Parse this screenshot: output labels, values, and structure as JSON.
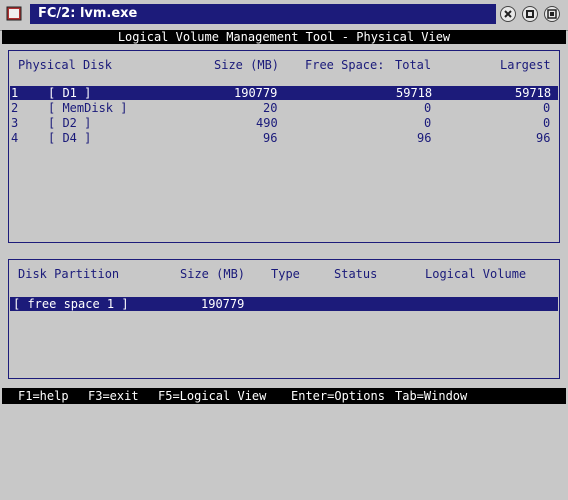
{
  "window": {
    "title": "FC/2: lvm.exe"
  },
  "header": {
    "title": "Logical Volume Management Tool - Physical View"
  },
  "disks_panel": {
    "columns": {
      "name": "Physical Disk",
      "size": "Size (MB)",
      "free": "Free Space:",
      "total": "Total",
      "largest": "Largest"
    },
    "rows": [
      {
        "num": "1",
        "name": "[ D1 ]",
        "size": "190779",
        "total": "59718",
        "largest": "59718",
        "selected": true
      },
      {
        "num": "2",
        "name": "[ MemDisk ]",
        "size": "20",
        "total": "0",
        "largest": "0"
      },
      {
        "num": "3",
        "name": "[ D2 ]",
        "size": "490",
        "total": "0",
        "largest": "0"
      },
      {
        "num": "4",
        "name": "[ D4 ]",
        "size": "96",
        "total": "96",
        "largest": "96"
      }
    ]
  },
  "partitions_panel": {
    "columns": {
      "name": "Disk Partition",
      "size": "Size (MB)",
      "type": "Type",
      "status": "Status",
      "volume": "Logical Volume"
    },
    "rows": [
      {
        "name": "[ free space 1 ]",
        "size": "190779",
        "selected": true
      }
    ]
  },
  "footer": {
    "help": "F1=help",
    "exit": "F3=exit",
    "logical": "F5=Logical View",
    "options": "Enter=Options",
    "window": "Tab=Window"
  },
  "colors": {
    "accent": "#1c1b7a",
    "background": "#c8c8c8",
    "text": "#1a1a7a"
  }
}
